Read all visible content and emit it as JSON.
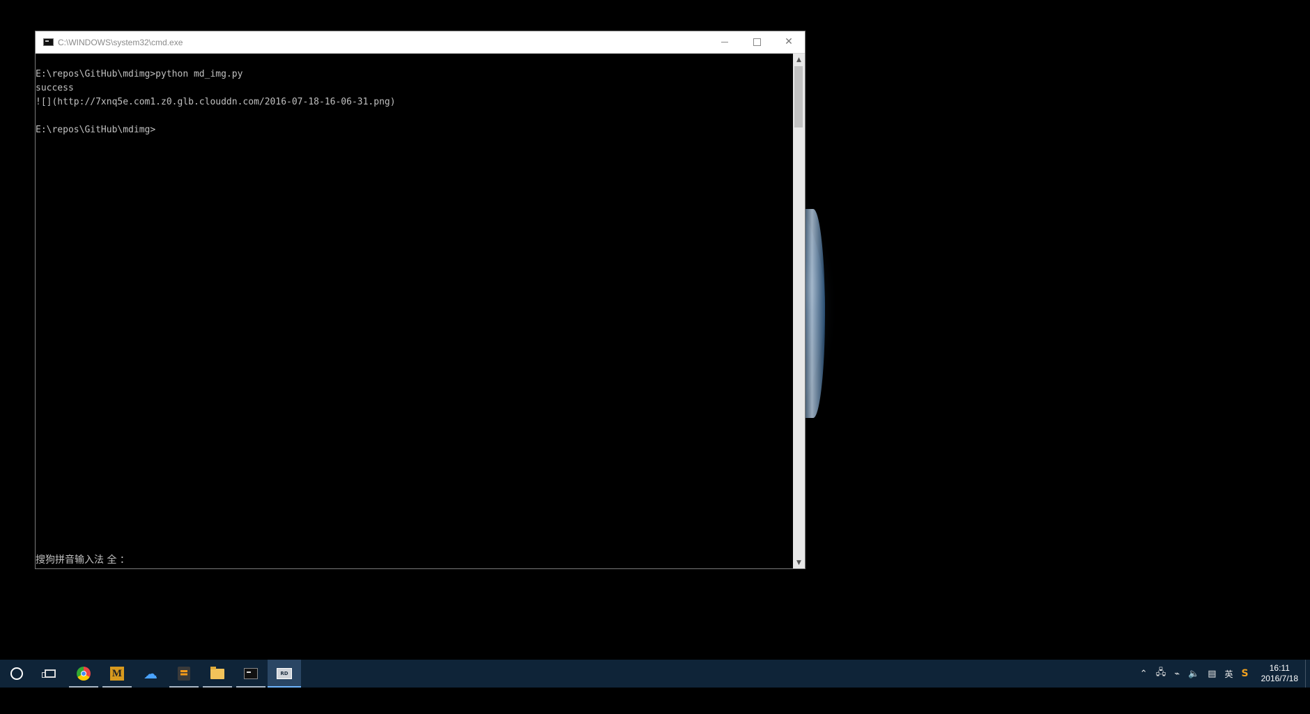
{
  "window": {
    "title": "C:\\WINDOWS\\system32\\cmd.exe"
  },
  "console": {
    "lines": [
      "E:\\repos\\GitHub\\mdimg>python md_img.py",
      "success",
      "![](http://7xnq5e.com1.z0.glb.clouddn.com/2016-07-18-16-06-31.png)",
      "",
      "E:\\repos\\GitHub\\mdimg>"
    ],
    "ime_status": "搜狗拼音输入法 全 ："
  },
  "taskbar": {
    "apps": [
      {
        "name": "cortana-search",
        "icon": "circle-icon"
      },
      {
        "name": "task-view",
        "icon": "task-view-icon"
      },
      {
        "name": "chrome",
        "icon": "chrome-icon"
      },
      {
        "name": "markdown-editor",
        "icon": "m-icon",
        "label": "M"
      },
      {
        "name": "cloud-upload",
        "icon": "cloud-icon"
      },
      {
        "name": "sublime-text",
        "icon": "sublime-icon"
      },
      {
        "name": "file-explorer",
        "icon": "folder-icon"
      },
      {
        "name": "command-prompt",
        "icon": "cmd-icon"
      },
      {
        "name": "remote-desktop",
        "icon": "remote-desktop-icon"
      }
    ],
    "tray": {
      "lang": "英",
      "sogou": "S",
      "time": "16:11",
      "date": "2016/7/18"
    }
  }
}
